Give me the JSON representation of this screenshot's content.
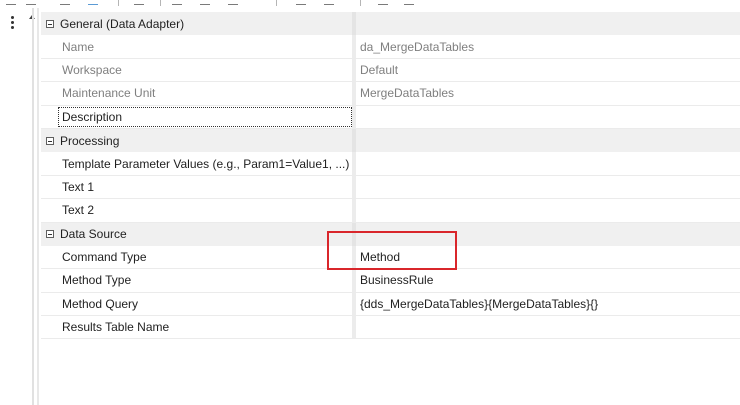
{
  "categories": [
    {
      "label": "General (Data Adapter)",
      "properties": [
        {
          "name": "Name",
          "value": "da_MergeDataTables",
          "readonly": true
        },
        {
          "name": "Workspace",
          "value": "Default",
          "readonly": true
        },
        {
          "name": "Maintenance Unit",
          "value": "MergeDataTables",
          "readonly": true
        },
        {
          "name": "Description",
          "value": "",
          "readonly": false
        }
      ]
    },
    {
      "label": "Processing",
      "properties": [
        {
          "name": "Template Parameter Values (e.g., Param1=Value1, ...)",
          "value": ""
        },
        {
          "name": "Text 1",
          "value": ""
        },
        {
          "name": "Text 2",
          "value": ""
        }
      ]
    },
    {
      "label": "Data Source",
      "properties": [
        {
          "name": "Command Type",
          "value": "Method"
        },
        {
          "name": "Method Type",
          "value": "BusinessRule"
        },
        {
          "name": "Method Query",
          "value": "{dds_MergeDataTables}{MergeDataTables}{}"
        },
        {
          "name": "Results Table Name",
          "value": ""
        }
      ]
    }
  ],
  "colors": {
    "highlight": "#d9262b",
    "category_bg": "#f0f0f0"
  }
}
